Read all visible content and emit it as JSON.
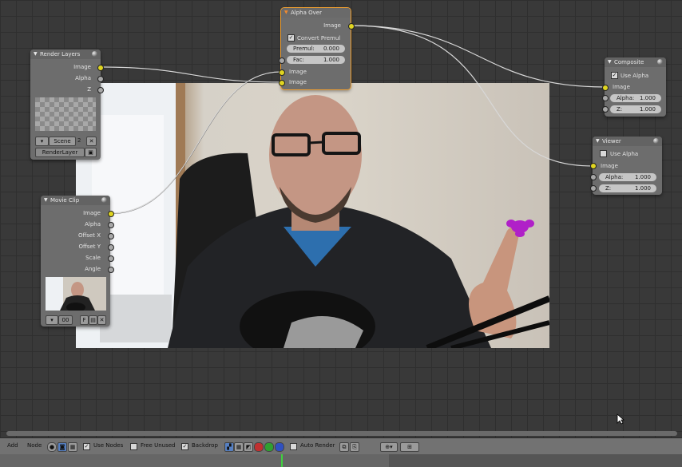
{
  "nodes": {
    "alpha_over": {
      "title": "Alpha Over",
      "out_image": "Image",
      "convert_premul": "Convert Premul",
      "premul_label": "Premul:",
      "premul_value": "0.000",
      "fac_label": "Fac:",
      "fac_value": "1.000",
      "in_image1": "Image",
      "in_image2": "Image"
    },
    "render_layers": {
      "title": "Render Layers",
      "out_image": "Image",
      "out_alpha": "Alpha",
      "out_z": "Z",
      "scene": "Scene",
      "scene_users": "2",
      "layer": "RenderLayer"
    },
    "movie_clip": {
      "title": "Movie Clip",
      "outputs": [
        "Image",
        "Alpha",
        "Offset X",
        "Offset Y",
        "Scale",
        "Angle"
      ],
      "clip_users": "00",
      "fake_user": "F"
    },
    "composite": {
      "title": "Composite",
      "use_alpha": "Use Alpha",
      "in_image": "Image",
      "alpha_label": "Alpha:",
      "alpha_value": "1.000",
      "z_label": "Z:",
      "z_value": "1.000"
    },
    "viewer": {
      "title": "Viewer",
      "use_alpha": "Use Alpha",
      "in_image": "Image",
      "alpha_label": "Alpha:",
      "alpha_value": "1.000",
      "z_label": "Z:",
      "z_value": "1.000"
    }
  },
  "footer": {
    "add": "Add",
    "node": "Node",
    "use_nodes": "Use Nodes",
    "free_unused": "Free Unused",
    "backdrop": "Backdrop",
    "auto_render": "Auto Render"
  },
  "colors": {
    "grid_bg": "#393939",
    "node_bg": "#6d6d6d",
    "socket_image": "#e0d520",
    "socket_value": "#a8a8a8",
    "selected": "#f0a030",
    "marker": "#a020c0"
  }
}
